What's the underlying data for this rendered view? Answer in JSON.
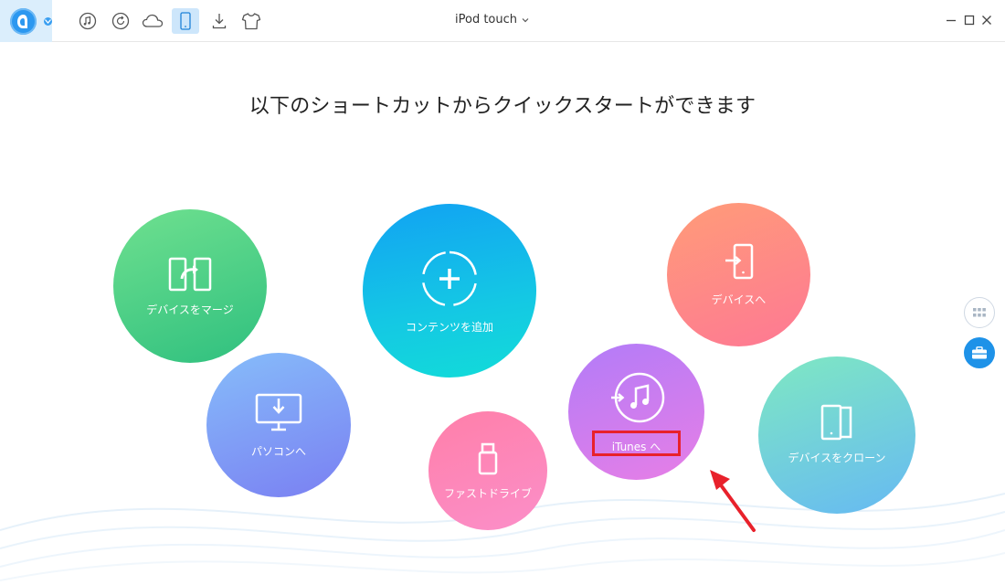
{
  "toolbar": {
    "logo": "airmore-a-logo",
    "icons": [
      "music-note-icon",
      "restore-icon",
      "cloud-icon",
      "device-icon",
      "download-icon",
      "tshirt-icon"
    ],
    "active_icon": "device-icon",
    "device_name": "iPod touch",
    "window_controls": [
      "minimize-icon",
      "maximize-icon",
      "close-icon"
    ]
  },
  "main": {
    "headline": "以下のショートカットからクイックスタートができます",
    "shortcuts": {
      "merge": "デバイスをマージ",
      "to_pc": "パソコンへ",
      "add_content": "コンテンツを追加",
      "flash_drive": "ファストドライブ",
      "to_itunes": "iTunes へ",
      "to_device": "デバイスへ",
      "clone_device": "デバイスをクローン"
    }
  },
  "side": {
    "buttons": [
      "grid-icon",
      "toolbox-icon"
    ]
  },
  "colors": {
    "accent": "#1e92e8",
    "highlight_box": "#e8212b",
    "annotation_arrow": "#e8212b"
  }
}
